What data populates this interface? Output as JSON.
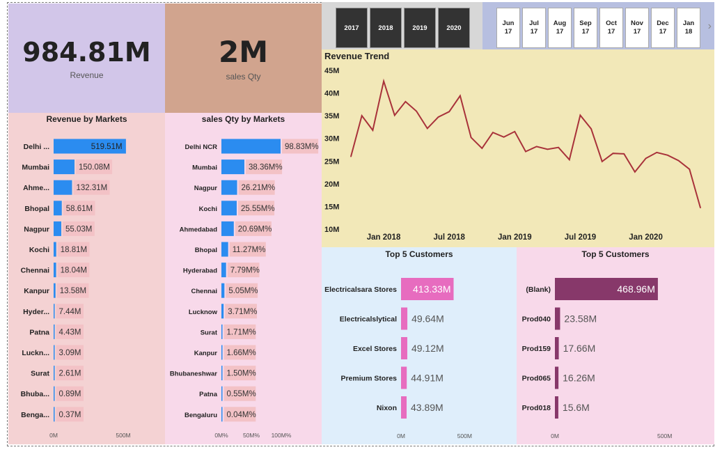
{
  "kpis": {
    "revenue": {
      "value": "984.81M",
      "label": "Revenue"
    },
    "qty": {
      "value": "2M",
      "label": "sales Qty"
    }
  },
  "slicers": {
    "years": [
      "2017",
      "2018",
      "2019",
      "2020"
    ],
    "months": [
      {
        "month": "Jun",
        "year": "17"
      },
      {
        "month": "Jul",
        "year": "17"
      },
      {
        "month": "Aug",
        "year": "17"
      },
      {
        "month": "Sep",
        "year": "17"
      },
      {
        "month": "Oct",
        "year": "17"
      },
      {
        "month": "Nov",
        "year": "17"
      },
      {
        "month": "Dec",
        "year": "17"
      },
      {
        "month": "Jan",
        "year": "18"
      }
    ],
    "next_icon": "chevron-right-icon"
  },
  "colors": {
    "revenue_bg": "#d2c6e9",
    "qty_bg": "#d1a48e",
    "markets_bg": "#f4d2d3",
    "qty_markets_bg": "#f8d9ea",
    "slicer_bg": "#d7d7d7",
    "month_slicer_bg": "#b7bfe0",
    "trend_bg": "#f2e8b8",
    "customers_bg": "#dfeefb",
    "products_bg": "#f8d9ea",
    "bar_blue": "#2b8cf0",
    "label_pink": "#f3c2c6",
    "line_red": "#a8323a",
    "customer_bar": "#e76cbf",
    "product_bar": "#87386a"
  },
  "chart_data": [
    {
      "type": "bar",
      "title": "Revenue by Markets",
      "categories": [
        "Delhi ...",
        "Mumbai",
        "Ahme...",
        "Bhopal",
        "Nagpur",
        "Kochi",
        "Chennai",
        "Kanpur",
        "Hyder...",
        "Patna",
        "Luckn...",
        "Surat",
        "Bhuba...",
        "Benga..."
      ],
      "values": [
        519.51,
        150.08,
        132.31,
        58.61,
        55.03,
        18.81,
        18.04,
        13.58,
        7.44,
        4.43,
        3.09,
        2.61,
        0.89,
        0.37
      ],
      "labels": [
        "519.51M",
        "150.08M",
        "132.31M",
        "58.61M",
        "55.03M",
        "18.81M",
        "18.04M",
        "13.58M",
        "7.44M",
        "4.43M",
        "3.09M",
        "2.61M",
        "0.89M",
        "0.37M"
      ],
      "xticks": [
        "0M",
        "500M"
      ],
      "xlim": [
        0,
        560
      ]
    },
    {
      "type": "bar",
      "title": "sales Qty by Markets",
      "categories": [
        "Delhi NCR",
        "Mumbai",
        "Nagpur",
        "Kochi",
        "Ahmedabad",
        "Bhopal",
        "Hyderabad",
        "Chennai",
        "Lucknow",
        "Surat",
        "Kanpur",
        "Bhubaneshwar",
        "Patna",
        "Bengaluru"
      ],
      "values": [
        98.83,
        38.36,
        26.21,
        25.55,
        20.69,
        11.27,
        7.79,
        5.05,
        3.71,
        1.71,
        1.66,
        1.5,
        0.55,
        0.04
      ],
      "labels": [
        "98.83M%",
        "38.36M%",
        "26.21M%",
        "25.55M%",
        "20.69M%",
        "11.27M%",
        "7.79M%",
        "5.05M%",
        "3.71M%",
        "1.71M%",
        "1.66M%",
        "1.50M%",
        "0.55M%",
        "0.04M%"
      ],
      "xticks": [
        "0M%",
        "50M%",
        "100M%"
      ],
      "xlim": [
        0,
        100
      ]
    },
    {
      "type": "line",
      "title": "Revenue Trend",
      "x": [
        "2017-10",
        "2017-11",
        "2017-12",
        "2018-01",
        "2018-02",
        "2018-03",
        "2018-04",
        "2018-05",
        "2018-06",
        "2018-07",
        "2018-08",
        "2018-09",
        "2018-10",
        "2018-11",
        "2018-12",
        "2019-01",
        "2019-02",
        "2019-03",
        "2019-04",
        "2019-05",
        "2019-06",
        "2019-07",
        "2019-08",
        "2019-09",
        "2019-10",
        "2019-11",
        "2019-12",
        "2020-01",
        "2020-02",
        "2020-03",
        "2020-04",
        "2020-05",
        "2020-06"
      ],
      "values": [
        26.0,
        35.0,
        31.8,
        42.6,
        35.1,
        38.1,
        36.0,
        32.2,
        34.7,
        35.9,
        39.4,
        30.2,
        27.8,
        31.3,
        30.3,
        31.5,
        27.1,
        28.2,
        27.6,
        28.0,
        25.3,
        35.1,
        32.1,
        24.9,
        26.7,
        26.6,
        22.6,
        25.6,
        26.9,
        26.3,
        25.1,
        23.2,
        14.7
      ],
      "yticks": [
        "10M",
        "15M",
        "20M",
        "25M",
        "30M",
        "35M",
        "40M",
        "45M"
      ],
      "xticks": [
        "Jan 2018",
        "Jul 2018",
        "Jan 2019",
        "Jul 2019",
        "Jan 2020"
      ],
      "ylim": [
        10,
        45
      ],
      "unit": "M"
    },
    {
      "type": "bar",
      "title": "Top 5 Customers",
      "categories": [
        "Electricalsara Stores",
        "Electricalslytical",
        "Excel Stores",
        "Premium Stores",
        "Nixon"
      ],
      "values": [
        413.33,
        49.64,
        49.12,
        44.91,
        43.89
      ],
      "labels": [
        "413.33M",
        "49.64M",
        "49.12M",
        "44.91M",
        "43.89M"
      ],
      "xticks": [
        "0M",
        "500M"
      ],
      "xlim": [
        0,
        520
      ]
    },
    {
      "type": "bar",
      "title": "Top 5 Customers",
      "categories": [
        "(Blank)",
        "Prod040",
        "Prod159",
        "Prod065",
        "Prod018"
      ],
      "values": [
        468.96,
        23.58,
        17.66,
        16.26,
        15.6
      ],
      "labels": [
        "468.96M",
        "23.58M",
        "17.66M",
        "16.26M",
        "15.6M"
      ],
      "xticks": [
        "0M",
        "500M"
      ],
      "xlim": [
        0,
        520
      ]
    }
  ]
}
